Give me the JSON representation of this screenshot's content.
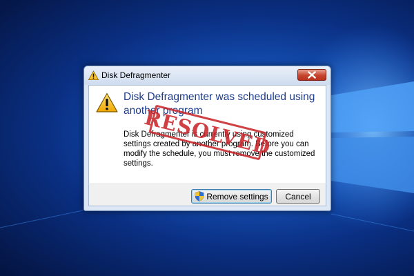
{
  "dialog": {
    "title": "Disk Defragmenter",
    "main_instruction": "Disk Defragmenter was scheduled using another program",
    "content": "Disk Defragmenter is currently using customized settings created by another program. Before you can modify the schedule, you must remove the customized settings.",
    "buttons": {
      "remove_settings": "Remove settings",
      "cancel": "Cancel"
    }
  },
  "stamp": {
    "text": "RESOLVED",
    "color": "#c9272c"
  },
  "icons": {
    "title": "warning-icon",
    "main": "warning-icon",
    "remove_button": "uac-shield-icon",
    "close": "close-icon"
  },
  "colors": {
    "instruction_text": "#1e3c8c",
    "close_button": "#c7452e"
  }
}
